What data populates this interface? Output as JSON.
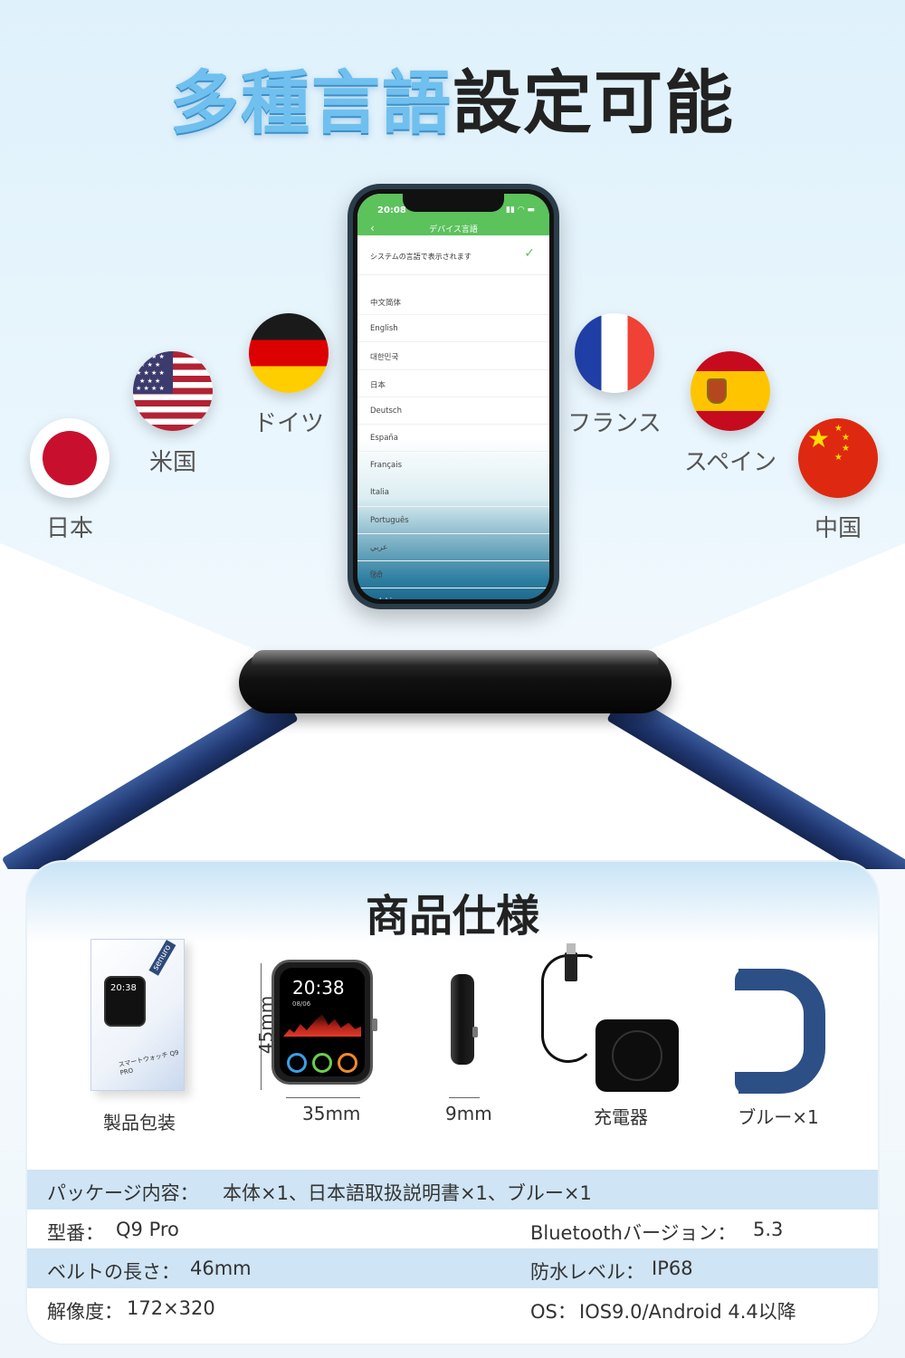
{
  "title": {
    "highlight": "多種言語",
    "rest": "設定可能"
  },
  "flags": {
    "japan": "日本",
    "usa": "米国",
    "germany": "ドイツ",
    "france": "フランス",
    "spain": "スペイン",
    "china": "中国"
  },
  "phone": {
    "time": "20:08",
    "nav_title": "デバイス言語",
    "system_option": "システムの言語で表示されます",
    "languages": [
      "中文简体",
      "English",
      "대한민국",
      "日本",
      "Deutsch",
      "España",
      "Français",
      "Italia",
      "Português",
      "عربي",
      "हिंदी",
      "Polskie"
    ]
  },
  "specs": {
    "heading": "商品仕様",
    "products": {
      "package": "製品包装",
      "charger": "充電器",
      "strap": "ブルー×1"
    },
    "box_text": {
      "brand": "senuro",
      "caption": "スマートウォッチ Q9 PRO",
      "time": "20:38"
    },
    "watch_screen": {
      "time": "20:38",
      "date": "08/06"
    },
    "dimensions": {
      "height": "45mm",
      "width": "35mm",
      "depth": "9mm"
    },
    "rows": {
      "package_label": "パッケージ内容：",
      "package_value": "本体×1、日本語取扱説明書×1、ブルー×1",
      "model_label": "型番：",
      "model_value": "Q9 Pro",
      "bt_label": "Bluetoothバージョン：",
      "bt_value": "5.3",
      "belt_label": "ベルトの長さ：",
      "belt_value": "46mm",
      "water_label": "防水レベル：",
      "water_value": "IP68",
      "res_label": "解像度：",
      "res_value": "172×320",
      "os_label": "OS：",
      "os_value": "IOS9.0/Android 4.4以降"
    }
  }
}
